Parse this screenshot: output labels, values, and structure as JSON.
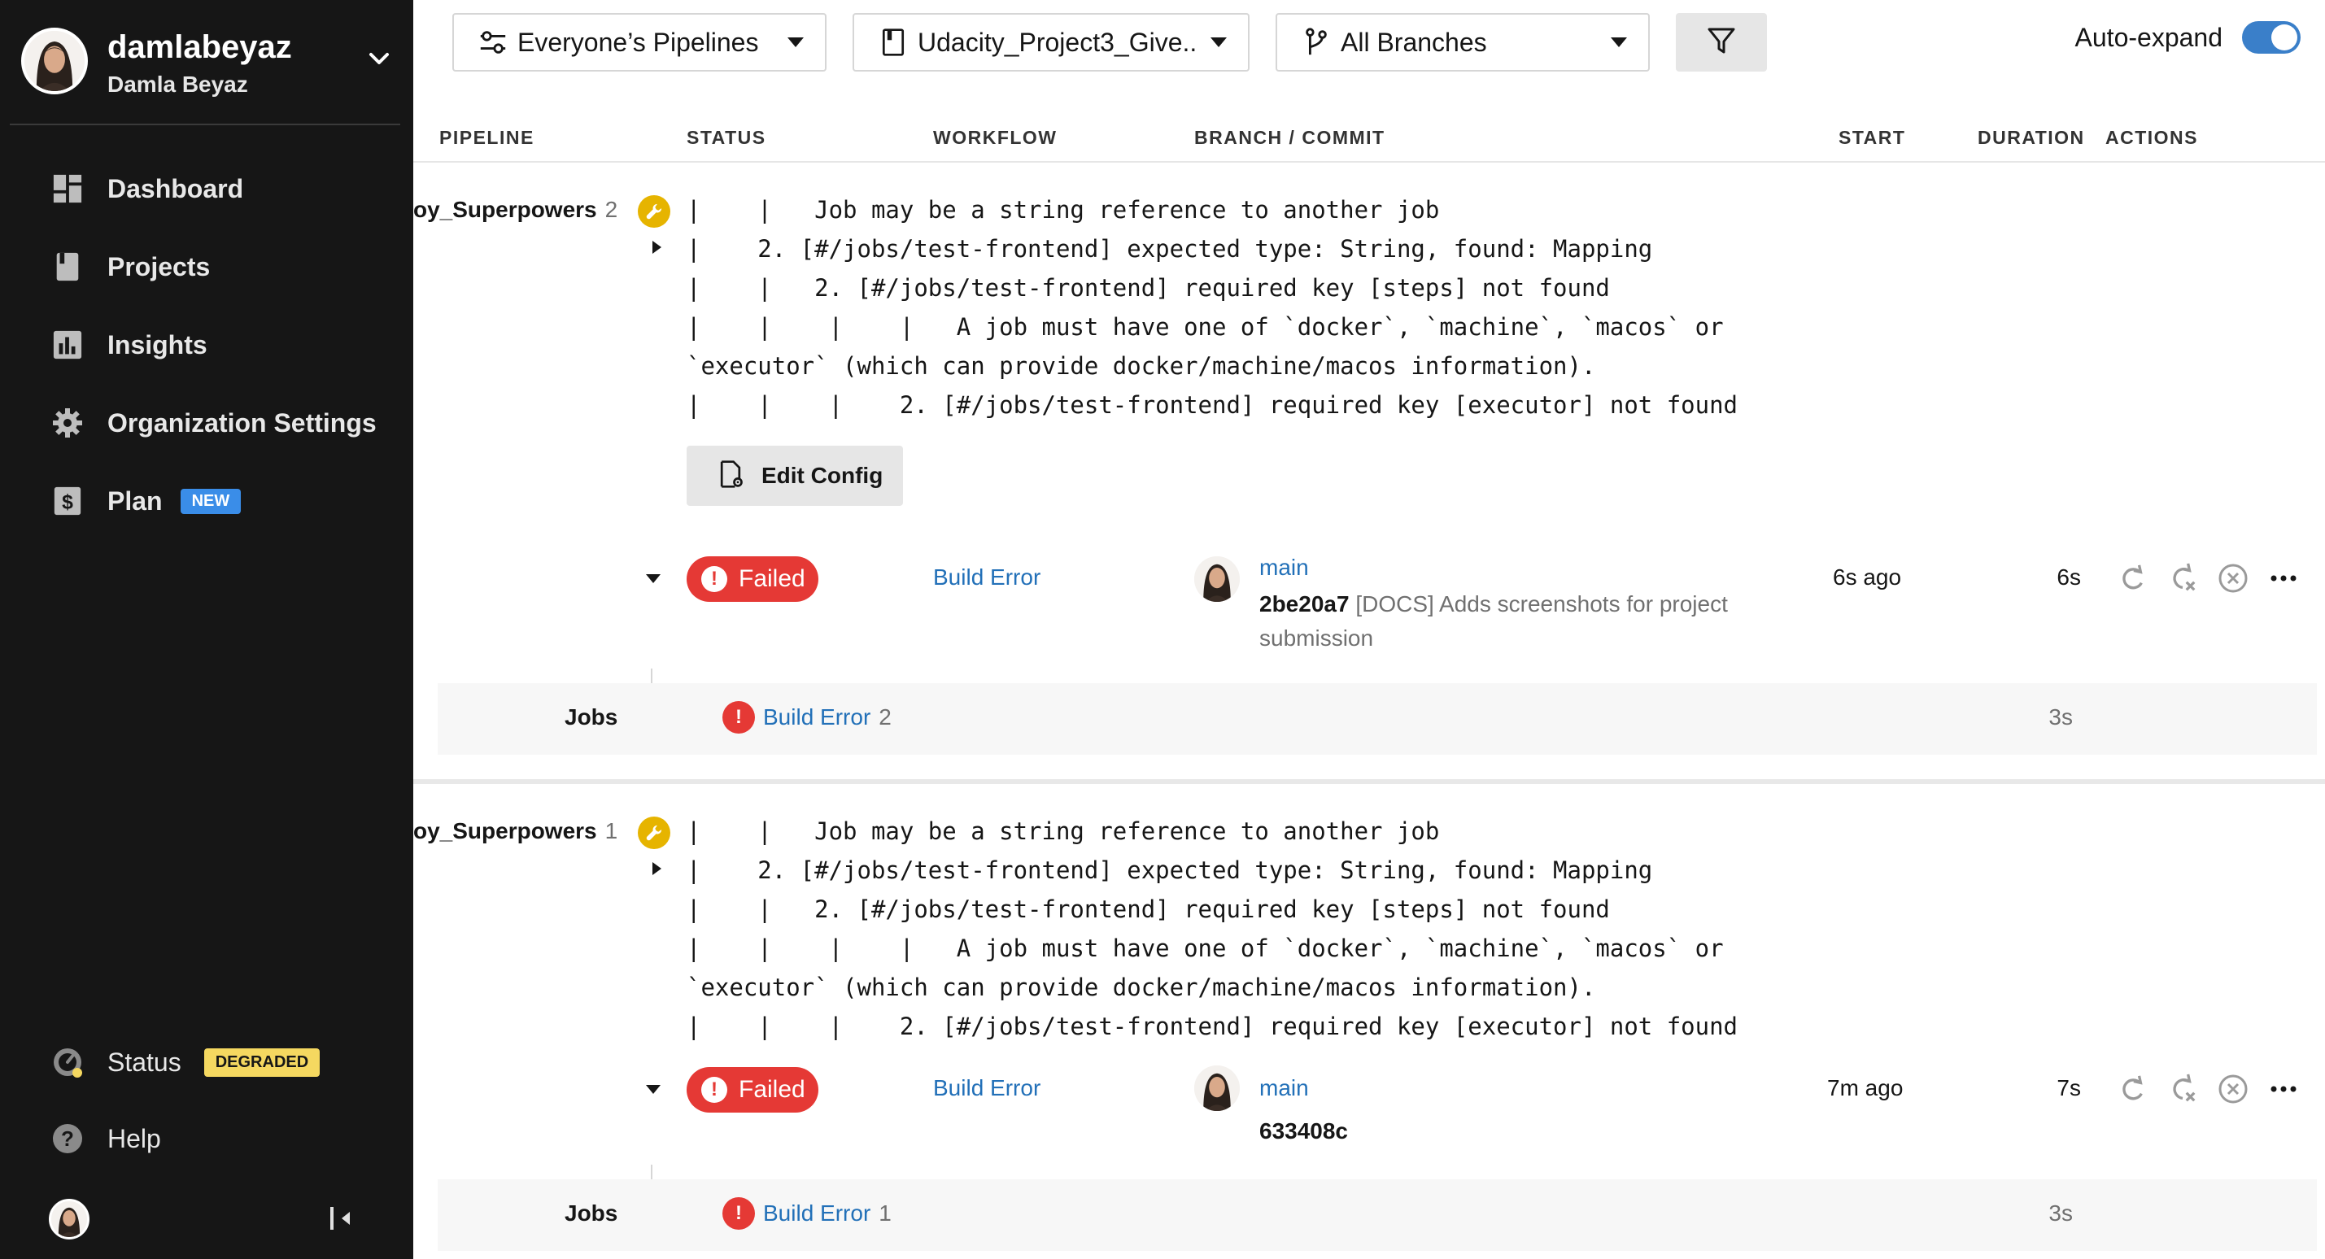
{
  "user": {
    "username": "damlabeyaz",
    "full_name": "Damla Beyaz"
  },
  "nav": {
    "dashboard": "Dashboard",
    "projects": "Projects",
    "insights": "Insights",
    "org_settings": "Organization Settings",
    "plan": "Plan",
    "plan_badge": "NEW",
    "status": "Status",
    "status_badge": "DEGRADED",
    "help": "Help"
  },
  "filters": {
    "pipelines": "Everyone’s Pipelines",
    "project": "Udacity_Project3_Give...",
    "branches": "All Branches",
    "auto_expand": "Auto-expand",
    "auto_expand_on": true
  },
  "columns": {
    "pipeline": "PIPELINE",
    "status": "STATUS",
    "workflow": "WORKFLOW",
    "branch_commit": "BRANCH / COMMIT",
    "start": "START",
    "duration": "DURATION",
    "actions": "ACTIONS"
  },
  "pipelines": [
    {
      "name": "oy_Superpowers",
      "number": "2",
      "error_text": "|    |   Job may be a string reference to another job\n|    2. [#/jobs/test-frontend] expected type: String, found: Mapping\n|    |   2. [#/jobs/test-frontend] required key [steps] not found\n|    |    |    |   A job must have one of `docker`, `machine`, `macos` or\n`executor` (which can provide docker/machine/macos information).\n|    |    |    2. [#/jobs/test-frontend] required key [executor] not found",
      "edit_config_label": "Edit Config",
      "status": "Failed",
      "workflow": "Build Error",
      "branch": "main",
      "commit_hash": "2be20a7",
      "commit_message": "[DOCS] Adds screenshots for project submission",
      "start": "6s ago",
      "duration": "6s",
      "jobs_label": "Jobs",
      "job_name": "Build Error",
      "job_number": "2",
      "job_duration": "3s"
    },
    {
      "name": "oy_Superpowers",
      "number": "1",
      "error_text": "|    |   Job may be a string reference to another job\n|    2. [#/jobs/test-frontend] expected type: String, found: Mapping\n|    |   2. [#/jobs/test-frontend] required key [steps] not found\n|    |    |    |   A job must have one of `docker`, `machine`, `macos` or\n`executor` (which can provide docker/machine/macos information).\n|    |    |    2. [#/jobs/test-frontend] required key [executor] not found",
      "status": "Failed",
      "workflow": "Build Error",
      "branch": "main",
      "commit_hash": "633408c",
      "start": "7m ago",
      "duration": "7s",
      "jobs_label": "Jobs",
      "job_name": "Build Error",
      "job_number": "1",
      "job_duration": "3s"
    }
  ],
  "icons": {
    "user_chevron": "chevron-down-icon",
    "dashboard": "dashboard-icon",
    "projects": "book-icon",
    "insights": "bar-chart-icon",
    "org_settings": "gear-icon",
    "plan": "dollar-icon",
    "status": "gauge-icon",
    "help": "help-icon",
    "collapse": "collapse-sidebar-icon",
    "pipelines_filter": "sliders-icon",
    "project_filter": "notebook-icon",
    "branch_filter": "branch-icon",
    "filter": "filter-icon",
    "config_error": "wrench-icon",
    "edit_config": "file-gear-icon",
    "rerun": "rerun-icon",
    "rerun_failed": "rerun-failed-icon",
    "cancel": "cancel-icon",
    "more": "more-icon"
  },
  "colors": {
    "sidebar_bg": "#161616",
    "failed": "#e53935",
    "link": "#2270b8",
    "toggle": "#3a7fc9",
    "badge_new": "#3a8de8",
    "badge_degraded": "#f5d860",
    "wrench": "#e6b400"
  }
}
